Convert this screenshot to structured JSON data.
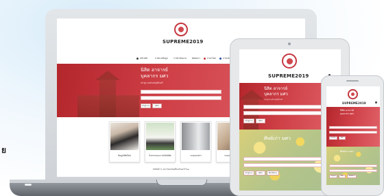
{
  "stray_text": "ย",
  "site": {
    "brand": "SUPREME2019",
    "hero_title_line1": "นิสิต อาจารย์",
    "hero_title_line2": "บุคลากร มศว",
    "hero_subtitle": "เข้าสู่ระบบด้วยบัญชีบัวศรี",
    "tablet_second_title": "ศิษย์เก่า มศว",
    "buttons": {
      "login": "เข้าสู่ระบบ",
      "register": "สมัคร",
      "forgot": "ลืมรหัสผ่าน"
    },
    "nav": [
      "หน้าหลัก",
      "ภาพรวมข้อมูล",
      "การดำเนินงาน",
      "ติดต่อเรา",
      "ภาษาไทย",
      "ภาษาอังกฤษ"
    ],
    "cards": [
      {
        "label": "ข้อมูลนิสิตใหม่",
        "icon": "students-photo"
      },
      {
        "label": "กิจกรรมและงานวิจัยนิสิต",
        "icon": "graduates-photo"
      },
      {
        "label": "ระบบเอกสาร",
        "icon": "door-photo"
      },
      {
        "label": "ระบบสารสนเทศ",
        "icon": "camera-photo"
      }
    ],
    "footer": "ลิขสิทธิ์ © มหาวิทยาลัยศรีนครินทรวิโรฒ"
  },
  "colors": {
    "primary_red": "#c4373f",
    "hero_gradient_start": "#b3262c",
    "hero_gradient_end": "#e06369"
  }
}
